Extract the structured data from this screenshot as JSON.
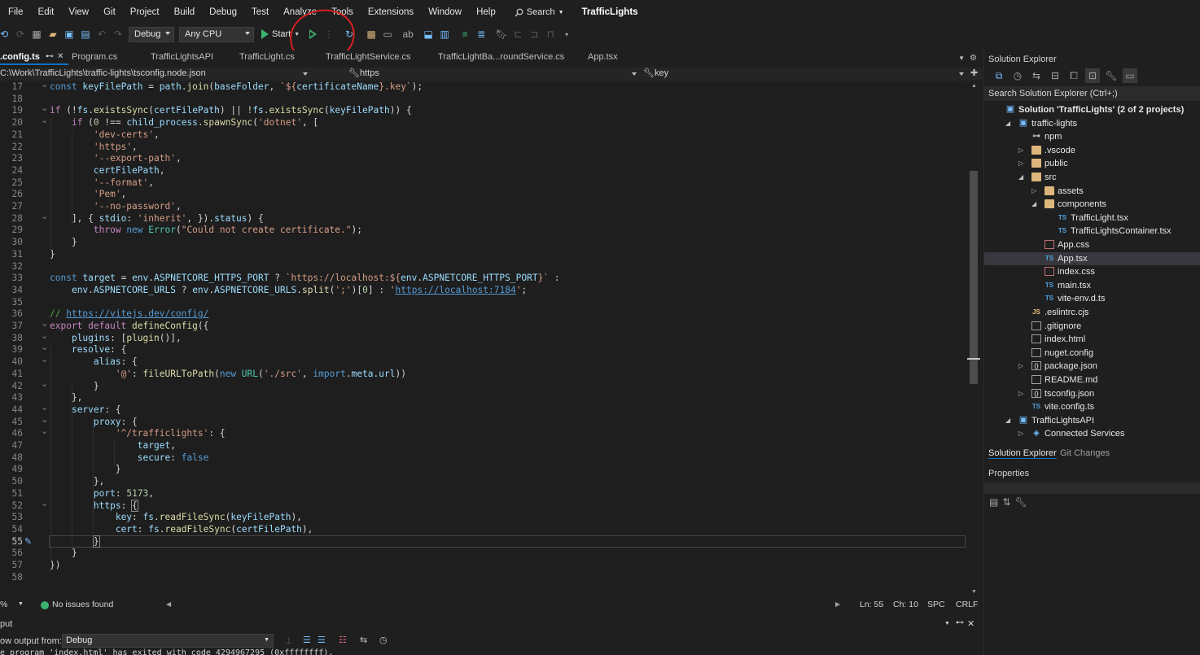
{
  "menu": [
    "File",
    "Edit",
    "View",
    "Git",
    "Project",
    "Build",
    "Debug",
    "Test",
    "Analyze",
    "Tools",
    "Extensions",
    "Window",
    "Help"
  ],
  "search": {
    "label": "Search"
  },
  "solution_name": "TrafficLights",
  "toolbar": {
    "config": "Debug",
    "platform": "Any CPU",
    "start_label": "Start"
  },
  "tabs": [
    {
      "label": ".config.ts",
      "active": true
    },
    {
      "label": "Program.cs"
    },
    {
      "label": "TrafficLightsAPI"
    },
    {
      "label": "TrafficLight.cs"
    },
    {
      "label": "TrafficLightService.cs"
    },
    {
      "label": "TrafficLightBa...roundService.cs"
    },
    {
      "label": "App.tsx"
    }
  ],
  "navbar": {
    "path": "C:\\Work\\TrafficLights\\traffic-lights\\tsconfig.node.json",
    "scope": "https",
    "member": "key"
  },
  "editor": {
    "lines": [
      {
        "n": "17",
        "segs": [
          [
            "k",
            "const "
          ],
          [
            "v",
            "keyFilePath "
          ],
          [
            "p",
            "= "
          ],
          [
            "v",
            "path"
          ],
          [
            "p",
            "."
          ],
          [
            "f",
            "join"
          ],
          [
            "p",
            "("
          ],
          [
            "v",
            "baseFolder"
          ],
          [
            "p",
            ", "
          ],
          [
            "s",
            "`${"
          ],
          [
            "v",
            "certificateName"
          ],
          [
            "s",
            "}.key`"
          ],
          [
            "p",
            ");"
          ]
        ]
      },
      {
        "n": "18",
        "segs": []
      },
      {
        "n": "19",
        "segs": [
          [
            "kc",
            "if "
          ],
          [
            "p",
            "(!"
          ],
          [
            "v",
            "fs"
          ],
          [
            "p",
            "."
          ],
          [
            "f",
            "existsSync"
          ],
          [
            "p",
            "("
          ],
          [
            "v",
            "certFilePath"
          ],
          [
            "p",
            ") || !"
          ],
          [
            "v",
            "fs"
          ],
          [
            "p",
            "."
          ],
          [
            "f",
            "existsSync"
          ],
          [
            "p",
            "("
          ],
          [
            "v",
            "keyFilePath"
          ],
          [
            "p",
            ")) {"
          ]
        ]
      },
      {
        "n": "20",
        "segs": [
          [
            "p",
            "    "
          ],
          [
            "kc",
            "if "
          ],
          [
            "p",
            "("
          ],
          [
            "n",
            "0 "
          ],
          [
            "p",
            "!== "
          ],
          [
            "v",
            "child_process"
          ],
          [
            "p",
            "."
          ],
          [
            "f",
            "spawnSync"
          ],
          [
            "p",
            "("
          ],
          [
            "s",
            "'dotnet'"
          ],
          [
            "p",
            ", ["
          ]
        ]
      },
      {
        "n": "21",
        "segs": [
          [
            "p",
            "        "
          ],
          [
            "s",
            "'dev-certs'"
          ],
          [
            "p",
            ","
          ]
        ]
      },
      {
        "n": "22",
        "segs": [
          [
            "p",
            "        "
          ],
          [
            "s",
            "'https'"
          ],
          [
            "p",
            ","
          ]
        ]
      },
      {
        "n": "23",
        "segs": [
          [
            "p",
            "        "
          ],
          [
            "s",
            "'--export-path'"
          ],
          [
            "p",
            ","
          ]
        ]
      },
      {
        "n": "24",
        "segs": [
          [
            "p",
            "        "
          ],
          [
            "v",
            "certFilePath"
          ],
          [
            "p",
            ","
          ]
        ]
      },
      {
        "n": "25",
        "segs": [
          [
            "p",
            "        "
          ],
          [
            "s",
            "'--format'"
          ],
          [
            "p",
            ","
          ]
        ]
      },
      {
        "n": "26",
        "segs": [
          [
            "p",
            "        "
          ],
          [
            "s",
            "'Pem'"
          ],
          [
            "p",
            ","
          ]
        ]
      },
      {
        "n": "27",
        "segs": [
          [
            "p",
            "        "
          ],
          [
            "s",
            "'--no-password'"
          ],
          [
            "p",
            ","
          ]
        ]
      },
      {
        "n": "28",
        "segs": [
          [
            "p",
            "    ], { "
          ],
          [
            "v",
            "stdio"
          ],
          [
            "p",
            ": "
          ],
          [
            "s",
            "'inherit'"
          ],
          [
            "p",
            ", })."
          ],
          [
            "v",
            "status"
          ],
          [
            "p",
            ") {"
          ]
        ]
      },
      {
        "n": "29",
        "segs": [
          [
            "p",
            "        "
          ],
          [
            "kc",
            "throw "
          ],
          [
            "k",
            "new "
          ],
          [
            "t",
            "Error"
          ],
          [
            "p",
            "("
          ],
          [
            "s",
            "\"Could not create certificate.\""
          ],
          [
            "p",
            ");"
          ]
        ]
      },
      {
        "n": "30",
        "segs": [
          [
            "p",
            "    }"
          ]
        ]
      },
      {
        "n": "31",
        "segs": [
          [
            "p",
            "}"
          ]
        ]
      },
      {
        "n": "32",
        "segs": []
      },
      {
        "n": "33",
        "segs": [
          [
            "k",
            "const "
          ],
          [
            "v",
            "target "
          ],
          [
            "p",
            "= "
          ],
          [
            "v",
            "env"
          ],
          [
            "p",
            "."
          ],
          [
            "v",
            "ASPNETCORE_HTTPS_PORT "
          ],
          [
            "p",
            "? "
          ],
          [
            "s",
            "`https://localhost:${"
          ],
          [
            "v",
            "env"
          ],
          [
            "p",
            "."
          ],
          [
            "v",
            "ASPNETCORE_HTTPS_PORT"
          ],
          [
            "s",
            "}`"
          ],
          [
            "p",
            " :"
          ]
        ]
      },
      {
        "n": "34",
        "segs": [
          [
            "p",
            "    "
          ],
          [
            "v",
            "env"
          ],
          [
            "p",
            "."
          ],
          [
            "v",
            "ASPNETCORE_URLS "
          ],
          [
            "p",
            "? "
          ],
          [
            "v",
            "env"
          ],
          [
            "p",
            "."
          ],
          [
            "v",
            "ASPNETCORE_URLS"
          ],
          [
            "p",
            "."
          ],
          [
            "f",
            "split"
          ],
          [
            "p",
            "("
          ],
          [
            "s",
            "';'"
          ],
          [
            "p",
            ")["
          ],
          [
            "n",
            "0"
          ],
          [
            "p",
            "] : "
          ],
          [
            "s",
            "'"
          ],
          [
            "u",
            "https://localhost:7184"
          ],
          [
            "s",
            "'"
          ],
          [
            "p",
            ";"
          ]
        ]
      },
      {
        "n": "35",
        "segs": []
      },
      {
        "n": "36",
        "segs": [
          [
            "c",
            "// "
          ],
          [
            "u",
            "https://vitejs.dev/config/"
          ]
        ]
      },
      {
        "n": "37",
        "segs": [
          [
            "kc",
            "export default "
          ],
          [
            "f",
            "defineConfig"
          ],
          [
            "p",
            "({"
          ]
        ]
      },
      {
        "n": "38",
        "segs": [
          [
            "p",
            "    "
          ],
          [
            "v",
            "plugins"
          ],
          [
            "p",
            ": ["
          ],
          [
            "f",
            "plugin"
          ],
          [
            "p",
            "()],"
          ]
        ]
      },
      {
        "n": "39",
        "segs": [
          [
            "p",
            "    "
          ],
          [
            "v",
            "resolve"
          ],
          [
            "p",
            ": {"
          ]
        ]
      },
      {
        "n": "40",
        "segs": [
          [
            "p",
            "        "
          ],
          [
            "v",
            "alias"
          ],
          [
            "p",
            ": {"
          ]
        ]
      },
      {
        "n": "41",
        "segs": [
          [
            "p",
            "            "
          ],
          [
            "s",
            "'@'"
          ],
          [
            "p",
            ": "
          ],
          [
            "f",
            "fileURLToPath"
          ],
          [
            "p",
            "("
          ],
          [
            "k",
            "new "
          ],
          [
            "t",
            "URL"
          ],
          [
            "p",
            "("
          ],
          [
            "s",
            "'./src'"
          ],
          [
            "p",
            ", "
          ],
          [
            "k",
            "import"
          ],
          [
            "p",
            "."
          ],
          [
            "v",
            "meta"
          ],
          [
            "p",
            "."
          ],
          [
            "v",
            "url"
          ],
          [
            "p",
            "))"
          ]
        ]
      },
      {
        "n": "42",
        "segs": [
          [
            "p",
            "        }"
          ]
        ]
      },
      {
        "n": "43",
        "segs": [
          [
            "p",
            "    },"
          ]
        ]
      },
      {
        "n": "44",
        "segs": [
          [
            "p",
            "    "
          ],
          [
            "v",
            "server"
          ],
          [
            "p",
            ": {"
          ]
        ]
      },
      {
        "n": "45",
        "segs": [
          [
            "p",
            "        "
          ],
          [
            "v",
            "proxy"
          ],
          [
            "p",
            ": {"
          ]
        ]
      },
      {
        "n": "46",
        "segs": [
          [
            "p",
            "            "
          ],
          [
            "s",
            "'^/trafficlights'"
          ],
          [
            "p",
            ": {"
          ]
        ]
      },
      {
        "n": "47",
        "segs": [
          [
            "p",
            "                "
          ],
          [
            "v",
            "target"
          ],
          [
            "p",
            ","
          ]
        ]
      },
      {
        "n": "48",
        "segs": [
          [
            "p",
            "                "
          ],
          [
            "v",
            "secure"
          ],
          [
            "p",
            ": "
          ],
          [
            "k",
            "false"
          ]
        ]
      },
      {
        "n": "49",
        "segs": [
          [
            "p",
            "            }"
          ]
        ]
      },
      {
        "n": "50",
        "segs": [
          [
            "p",
            "        },"
          ]
        ]
      },
      {
        "n": "51",
        "segs": [
          [
            "p",
            "        "
          ],
          [
            "v",
            "port"
          ],
          [
            "p",
            ": "
          ],
          [
            "n",
            "5173"
          ],
          [
            "p",
            ","
          ]
        ]
      },
      {
        "n": "52",
        "segs": [
          [
            "p",
            "        "
          ],
          [
            "v",
            "https"
          ],
          [
            "p",
            ": "
          ],
          [
            "bm",
            "{"
          ]
        ]
      },
      {
        "n": "53",
        "segs": [
          [
            "p",
            "            "
          ],
          [
            "v",
            "key"
          ],
          [
            "p",
            ": "
          ],
          [
            "v",
            "fs"
          ],
          [
            "p",
            "."
          ],
          [
            "f",
            "readFileSync"
          ],
          [
            "p",
            "("
          ],
          [
            "v",
            "keyFilePath"
          ],
          [
            "p",
            "),"
          ]
        ]
      },
      {
        "n": "54",
        "segs": [
          [
            "p",
            "            "
          ],
          [
            "v",
            "cert"
          ],
          [
            "p",
            ": "
          ],
          [
            "v",
            "fs"
          ],
          [
            "p",
            "."
          ],
          [
            "f",
            "readFileSync"
          ],
          [
            "p",
            "("
          ],
          [
            "v",
            "certFilePath"
          ],
          [
            "p",
            "),"
          ]
        ]
      },
      {
        "n": "55",
        "segs": [
          [
            "p",
            "        "
          ],
          [
            "bm",
            "}"
          ]
        ],
        "current": true
      },
      {
        "n": "56",
        "segs": [
          [
            "p",
            "    }"
          ]
        ]
      },
      {
        "n": "57",
        "segs": [
          [
            "p",
            "})"
          ]
        ]
      },
      {
        "n": "58",
        "segs": []
      }
    ]
  },
  "status": {
    "zoom": "%",
    "issues": "No issues found",
    "ln": "Ln: 55",
    "ch": "Ch: 10",
    "spc": "SPC",
    "eol": "CRLF"
  },
  "output": {
    "title": "put",
    "from_label": "ow output from:",
    "source": "Debug",
    "text": "e program 'index.html' has exited with code 4294967295 (0xffffffff)."
  },
  "solution_explorer": {
    "title": "Solution Explorer",
    "search_placeholder": "Search Solution Explorer (Ctrl+;)",
    "tabs": [
      "Solution Explorer",
      "Git Changes"
    ],
    "properties": "Properties",
    "tree": [
      {
        "label": "Solution 'TrafficLights' (2 of 2 projects)",
        "icon": "solution-icon",
        "bold": true
      },
      {
        "label": "traffic-lights",
        "icon": "project-icon",
        "expand": "open"
      },
      {
        "label": "npm",
        "icon": "npm-icon"
      },
      {
        "label": ".vscode",
        "icon": "folder-icon",
        "expand": "closed"
      },
      {
        "label": "public",
        "icon": "folder-icon",
        "expand": "closed"
      },
      {
        "label": "src",
        "icon": "folder-icon",
        "expand": "open"
      },
      {
        "label": "assets",
        "icon": "folder-icon",
        "expand": "closed"
      },
      {
        "label": "components",
        "icon": "folder-icon",
        "expand": "open"
      },
      {
        "label": "TrafficLight.tsx",
        "icon": "ts-file-icon"
      },
      {
        "label": "TrafficLightsContainer.tsx",
        "icon": "ts-file-icon"
      },
      {
        "label": "App.css",
        "icon": "css-file-icon"
      },
      {
        "label": "App.tsx",
        "icon": "ts-file-icon",
        "selected": true
      },
      {
        "label": "index.css",
        "icon": "css-file-icon"
      },
      {
        "label": "main.tsx",
        "icon": "ts-file-icon"
      },
      {
        "label": "vite-env.d.ts",
        "icon": "ts-file-icon"
      },
      {
        "label": ".eslintrc.cjs",
        "icon": "js-file-icon"
      },
      {
        "label": ".gitignore",
        "icon": "file-icon"
      },
      {
        "label": "index.html",
        "icon": "file-icon"
      },
      {
        "label": "nuget.config",
        "icon": "config-file-icon"
      },
      {
        "label": "package.json",
        "icon": "json-file-icon",
        "expand": "closed"
      },
      {
        "label": "README.md",
        "icon": "md-file-icon"
      },
      {
        "label": "tsconfig.json",
        "icon": "json-file-icon",
        "expand": "closed"
      },
      {
        "label": "vite.config.ts",
        "icon": "ts-file-icon"
      },
      {
        "label": "TrafficLightsAPI",
        "icon": "project-icon",
        "expand": "open"
      },
      {
        "label": "Connected Services",
        "icon": "connected-services-icon",
        "expand": "closed"
      }
    ]
  },
  "colors": {
    "accent": "#0e70c0",
    "highlight_circle": "#d92020",
    "run_green": "#3cb371"
  }
}
